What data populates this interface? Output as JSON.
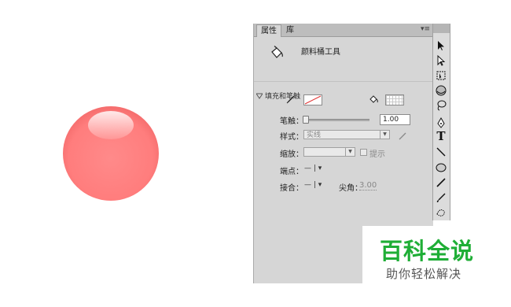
{
  "panel": {
    "tabs": [
      {
        "label": "属性"
      },
      {
        "label": "库"
      }
    ],
    "menu_icon": "panel-menu-icon",
    "tool": {
      "icon": "paint-bucket-icon",
      "name": "颜料桶工具"
    },
    "section": {
      "label": "填充和笔触",
      "icon": "collapse-triangle-icon"
    },
    "stroke_label": "笔触：",
    "stroke_value": "1.00",
    "style_label": "样式：",
    "style_value": "实线",
    "scale_label": "缩放：",
    "scale_value": "",
    "hint_label": "提示",
    "cap_label": "端点：",
    "cap_value": "—",
    "join_label": "接合：",
    "join_value": "—",
    "miter_label": "尖角：",
    "miter_value": "3.00"
  },
  "toolbar": {
    "tools": [
      "selection-tool-icon",
      "subselection-tool-icon",
      "free-transform-tool-icon",
      "3d-rotation-tool-icon",
      "lasso-tool-icon",
      "pen-tool-icon",
      "text-tool-icon",
      "line-tool-icon",
      "oval-tool-icon",
      "pencil-tool-icon",
      "brush-tool-icon",
      "deco-tool-icon"
    ],
    "text_tool_glyph": "T"
  },
  "stage": {
    "shape": "glossy-sphere",
    "color": "#ff7f7f"
  },
  "watermark": {
    "title": "百科全说",
    "subtitle": "助你轻松解决"
  }
}
